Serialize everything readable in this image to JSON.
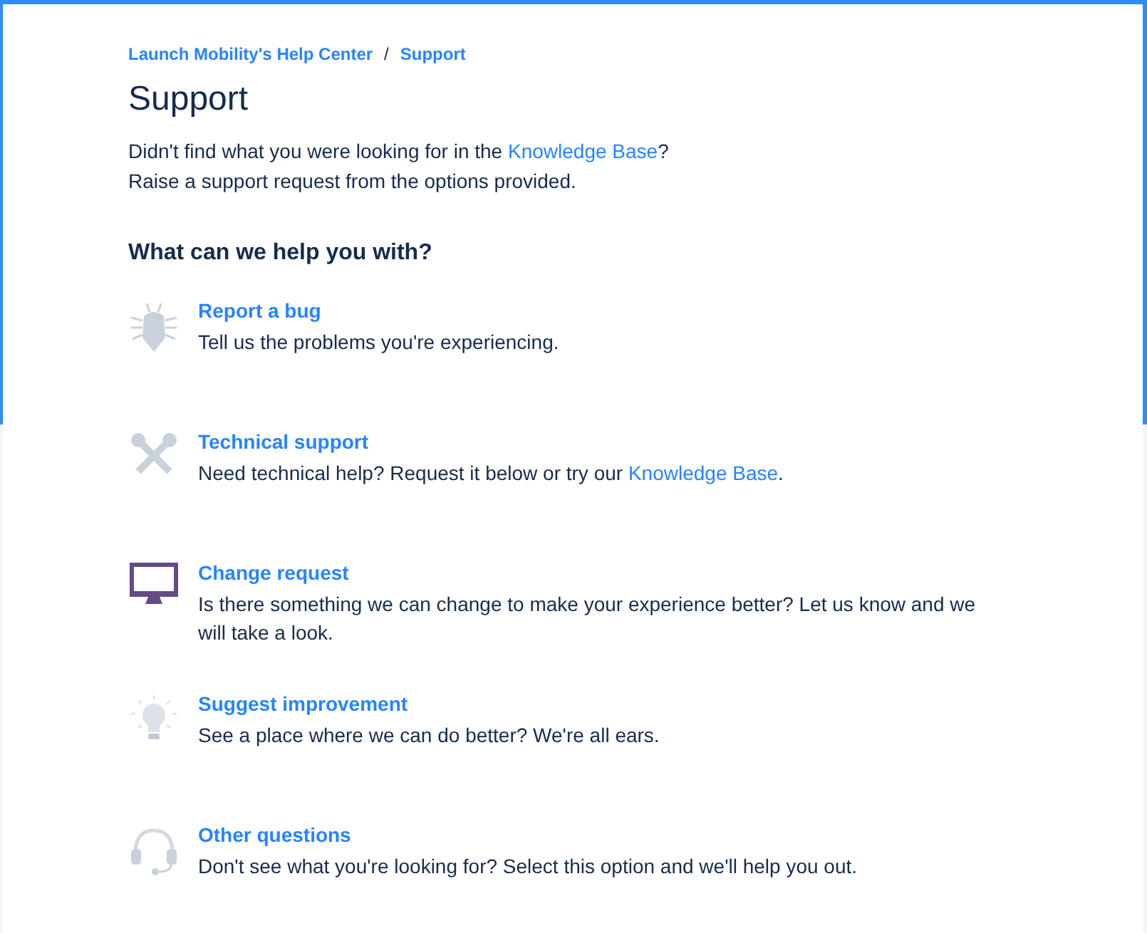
{
  "breadcrumb": [
    {
      "label": "Launch Mobility's Help Center"
    },
    {
      "label": "Support"
    }
  ],
  "breadcrumb_separator": "/",
  "title": "Support",
  "intro": [
    [
      {
        "text": "Didn't find what you were looking for in the ",
        "link": false
      },
      {
        "text": "Knowledge Base",
        "link": true
      },
      {
        "text": "?",
        "link": false
      }
    ],
    [
      {
        "text": "Raise a support request from the options provided.",
        "link": false
      }
    ]
  ],
  "heading": "What can we help you with?",
  "options": [
    {
      "kind": "bug",
      "title": "Report a bug",
      "description": [
        {
          "text": "Tell us the problems you're experiencing.",
          "link": false
        }
      ]
    },
    {
      "kind": "tools",
      "title": "Technical support",
      "description": [
        {
          "text": "Need technical help? Request it below or try our ",
          "link": false
        },
        {
          "text": "Knowledge Base",
          "link": true
        },
        {
          "text": ".",
          "link": false
        }
      ]
    },
    {
      "kind": "monitor",
      "title": "Change request",
      "description": [
        {
          "text": "Is there something we can change to make your experience better? Let us know and we will take a look.",
          "link": false
        }
      ]
    },
    {
      "kind": "bulb",
      "title": "Suggest improvement",
      "description": [
        {
          "text": "See a place where we can do better? We're all ears.",
          "link": false
        }
      ]
    },
    {
      "kind": "headset",
      "title": "Other questions",
      "description": [
        {
          "text": "Don't see what you're looking for? Select this option and we'll help you out.",
          "link": false
        }
      ]
    }
  ]
}
